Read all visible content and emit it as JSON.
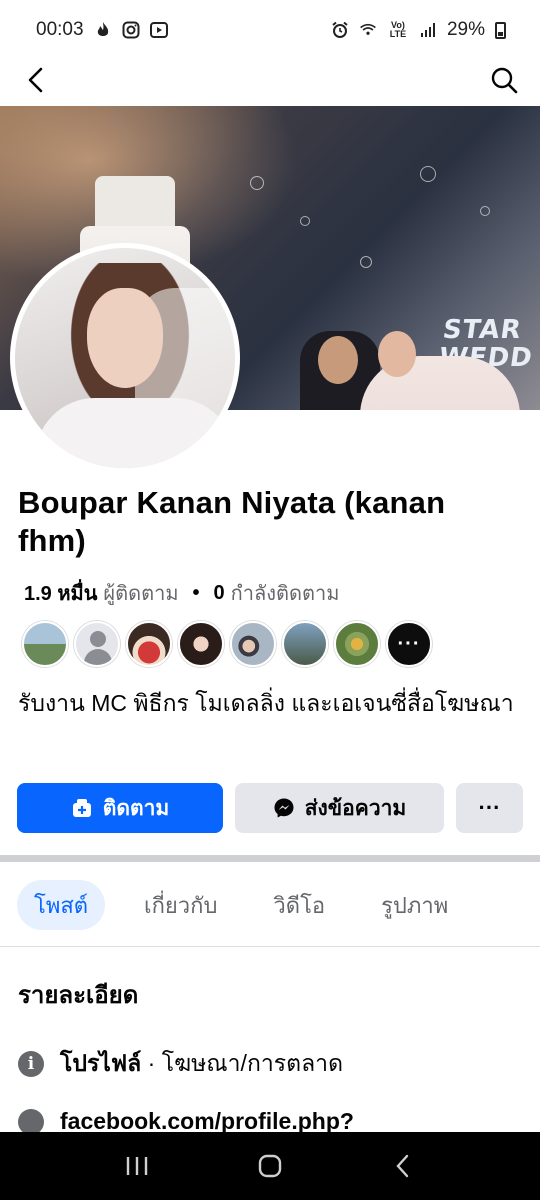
{
  "status_bar": {
    "time": "00:03",
    "battery": "29%",
    "icons": [
      "fire-icon",
      "instagram-icon",
      "media-icon",
      "alarm-icon",
      "wifi-calling-icon",
      "volte-icon",
      "signal-icon",
      "battery-icon"
    ]
  },
  "app_bar": {
    "back_icon": "back-arrow-icon",
    "search_icon": "search-icon"
  },
  "profile": {
    "name": "Boupar Kanan Niyata (kanan fhm)",
    "followers_count": "1.9 หมื่น",
    "followers_label": "ผู้ติดตาม",
    "separator": "•",
    "following_count": "0",
    "following_label": "กำลังติดตาม",
    "bio": "รับงาน MC พิธีกร โมเดลลิ่ง และเอเจนซี่สื่อโฆษณา",
    "more_followers": "···"
  },
  "cover": {
    "sign_text": "STAR WEDD"
  },
  "actions": {
    "follow_label": "ติดตาม",
    "message_label": "ส่งข้อความ",
    "more_label": "···"
  },
  "tabs": [
    {
      "label": "โพสต์",
      "active": true
    },
    {
      "label": "เกี่ยวกับ",
      "active": false
    },
    {
      "label": "วิดีโอ",
      "active": false
    },
    {
      "label": "รูปภาพ",
      "active": false
    }
  ],
  "details": {
    "title": "รายละเอียด",
    "category_label": "โปรไฟล์",
    "category_sep": "·",
    "category_value": "โฆษณา/การตลาด",
    "link": "facebook.com/profile.php?"
  },
  "nav_bar": {
    "recents_icon": "recents-icon",
    "home_icon": "home-icon",
    "back_icon": "back-icon"
  },
  "colors": {
    "accent": "#0866ff",
    "secondary_button": "#e4e6eb",
    "muted_text": "#65676b",
    "active_tab_bg": "#e7f0fe"
  }
}
